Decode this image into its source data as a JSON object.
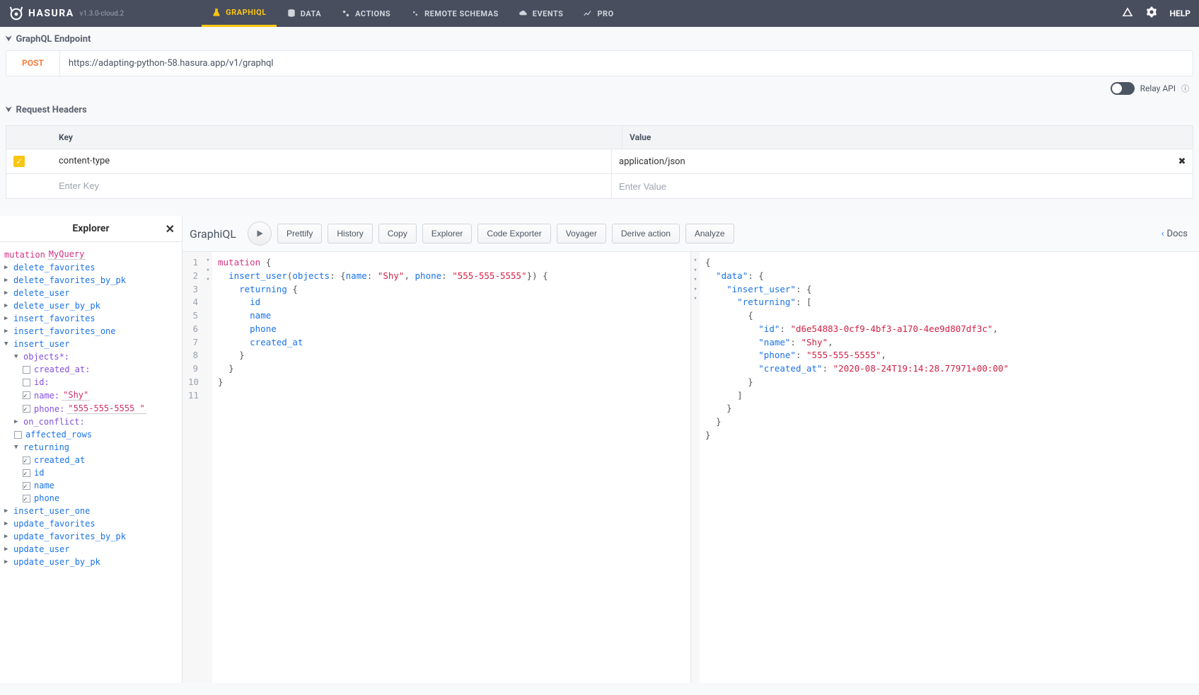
{
  "topnav": {
    "brand": "HASURA",
    "version": "v1.3.0-cloud.2",
    "items": [
      {
        "label": "GRAPHIQL",
        "active": true
      },
      {
        "label": "DATA"
      },
      {
        "label": "ACTIONS"
      },
      {
        "label": "REMOTE SCHEMAS"
      },
      {
        "label": "EVENTS"
      },
      {
        "label": "PRO"
      }
    ],
    "help": "HELP"
  },
  "endpoint": {
    "section_title": "GraphQL Endpoint",
    "method": "POST",
    "url": "https://adapting-python-58.hasura.app/v1/graphql"
  },
  "relay": {
    "label": "Relay API"
  },
  "headers": {
    "section_title": "Request Headers",
    "key_header": "Key",
    "value_header": "Value",
    "rows": [
      {
        "key": "content-type",
        "value": "application/json"
      }
    ],
    "key_placeholder": "Enter Key",
    "value_placeholder": "Enter Value"
  },
  "explorer": {
    "title": "Explorer",
    "mutation_kw": "mutation",
    "query_name": "MyQuery",
    "fields": {
      "delete_favorites": "delete_favorites",
      "delete_favorites_by_pk": "delete_favorites_by_pk",
      "delete_user": "delete_user",
      "delete_user_by_pk": "delete_user_by_pk",
      "insert_favorites": "insert_favorites",
      "insert_favorites_one": "insert_favorites_one",
      "insert_user": "insert_user",
      "objects": "objects*:",
      "created_at": "created_at:",
      "id": "id:",
      "name_arg": "name:",
      "name_val": "\"Shy\"",
      "phone_arg": "phone:",
      "phone_val": "\"555-555-5555 \"",
      "on_conflict": "on_conflict:",
      "affected_rows": "affected_rows",
      "returning": "returning",
      "ret_created_at": "created_at",
      "ret_id": "id",
      "ret_name": "name",
      "ret_phone": "phone",
      "insert_user_one": "insert_user_one",
      "update_favorites": "update_favorites",
      "update_favorites_by_pk": "update_favorites_by_pk",
      "update_user": "update_user",
      "update_user_by_pk": "update_user_by_pk"
    }
  },
  "graphiql": {
    "title": "GraphiQL",
    "buttons": {
      "prettify": "Prettify",
      "history": "History",
      "copy": "Copy",
      "explorer": "Explorer",
      "code_exporter": "Code Exporter",
      "voyager": "Voyager",
      "derive_action": "Derive action",
      "analyze": "Analyze"
    },
    "docs": "Docs"
  },
  "query": {
    "l1_kw": "mutation",
    "l1_brace": " {",
    "l2_fn": "insert_user",
    "l2_open": "(",
    "l2_objects": "objects",
    "l2_colon": ": {",
    "l2_name_k": "name",
    "l2_name_v": "\"Shy\"",
    "l2_phone_k": "phone",
    "l2_phone_v": "\"555-555-5555\"",
    "l2_close": "}) {",
    "l3": "returning",
    "l3_brace": " {",
    "l4": "id",
    "l5": "name",
    "l6": "phone",
    "l7": "created_at",
    "l8": "}",
    "l9": "}",
    "l10": "}"
  },
  "result": {
    "open": "{",
    "data_k": "\"data\"",
    "insert_user_k": "\"insert_user\"",
    "returning_k": "\"returning\"",
    "id_k": "\"id\"",
    "id_v": "\"d6e54883-0cf9-4bf3-a170-4ee9d807df3c\"",
    "name_k": "\"name\"",
    "name_v": "\"Shy\"",
    "phone_k": "\"phone\"",
    "phone_v": "\"555-555-5555\"",
    "created_at_k": "\"created_at\"",
    "created_at_v": "\"2020-08-24T19:14:28.77971+00:00\""
  }
}
